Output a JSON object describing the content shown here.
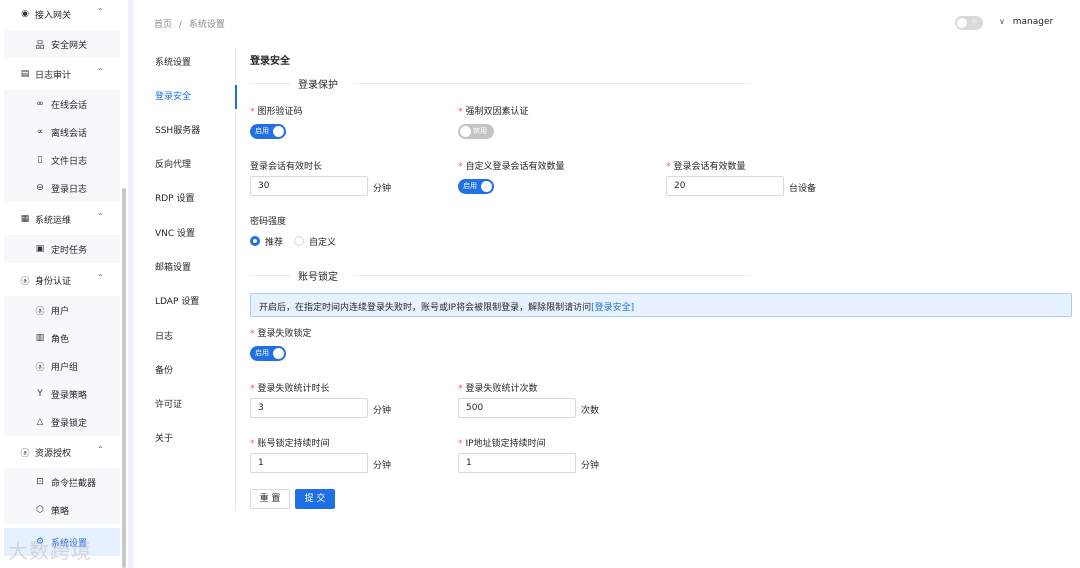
{
  "sidebar": {
    "groups": [
      {
        "label": "接入网关",
        "icon": "eye-icon"
      },
      {
        "label": "日志审计",
        "icon": "document-icon"
      },
      {
        "label": "系统运维",
        "icon": "grid-icon"
      },
      {
        "label": "身份认证",
        "icon": "user-icon"
      },
      {
        "label": "资源授权",
        "icon": "user-icon"
      }
    ],
    "items": [
      {
        "label": "安全网关",
        "icon": "network-icon"
      },
      {
        "label": "在线会话",
        "icon": "link-icon"
      },
      {
        "label": "离线会话",
        "icon": "link-broken-icon"
      },
      {
        "label": "文件日志",
        "icon": "file-icon"
      },
      {
        "label": "登录日志",
        "icon": "login-icon"
      },
      {
        "label": "定时任务",
        "icon": "calendar-icon"
      },
      {
        "label": "用户",
        "icon": "user-icon"
      },
      {
        "label": "角色",
        "icon": "role-icon"
      },
      {
        "label": "用户组",
        "icon": "users-icon"
      },
      {
        "label": "登录策略",
        "icon": "branch-icon"
      },
      {
        "label": "登录锁定",
        "icon": "warning-icon"
      },
      {
        "label": "命令拦截器",
        "icon": "terminal-icon"
      },
      {
        "label": "策略",
        "icon": "shield-icon"
      },
      {
        "label": "系统设置",
        "icon": "gear-icon"
      }
    ]
  },
  "header": {
    "breadcrumb": [
      "首页",
      "/",
      "系统设置"
    ],
    "username": "manager"
  },
  "settings_nav": [
    "系统设置",
    "登录安全",
    "SSH服务器",
    "反向代理",
    "RDP 设置",
    "VNC 设置",
    "邮箱设置",
    "LDAP 设置",
    "日志",
    "备份",
    "许可证",
    "关于"
  ],
  "form": {
    "title": "登录安全",
    "section1": "登录保护",
    "captcha_label": "图形验证码",
    "captcha_switch": "启用",
    "mfa_label": "强制双因素认证",
    "mfa_switch": "禁用",
    "session_duration_label": "登录会话有效时长",
    "session_duration_value": "30",
    "session_duration_unit": "分钟",
    "custom_session_count_label": "自定义登录会话有效数量",
    "custom_session_count_switch": "启用",
    "session_count_label": "登录会话有效数量",
    "session_count_value": "20",
    "session_count_unit": "台设备",
    "password_strength_label": "密码强度",
    "password_recommended": "推荐",
    "password_custom": "自定义",
    "section2": "账号锁定",
    "alert_text": "开启后，在指定时间内连续登录失败时，账号或IP将会被限制登录，解除限制请访问",
    "alert_link": "[登录安全]",
    "lock_label": "登录失败锁定",
    "lock_switch": "启用",
    "fail_window_label": "登录失败统计时长",
    "fail_window_value": "3",
    "fail_window_unit": "分钟",
    "fail_count_label": "登录失败统计次数",
    "fail_count_value": "500",
    "fail_count_unit": "次数",
    "account_lock_label": "账号锁定持续时间",
    "account_lock_value": "1",
    "account_lock_unit": "分钟",
    "ip_lock_label": "IP地址锁定持续时间",
    "ip_lock_value": "1",
    "ip_lock_unit": "分钟",
    "reset_button": "重 置",
    "submit_button": "提 交"
  },
  "watermark": "大数跨境",
  "colors": {
    "primary": "#1f6fe5",
    "required": "#ff4d4f",
    "alert_bg": "#e6f2ff"
  }
}
